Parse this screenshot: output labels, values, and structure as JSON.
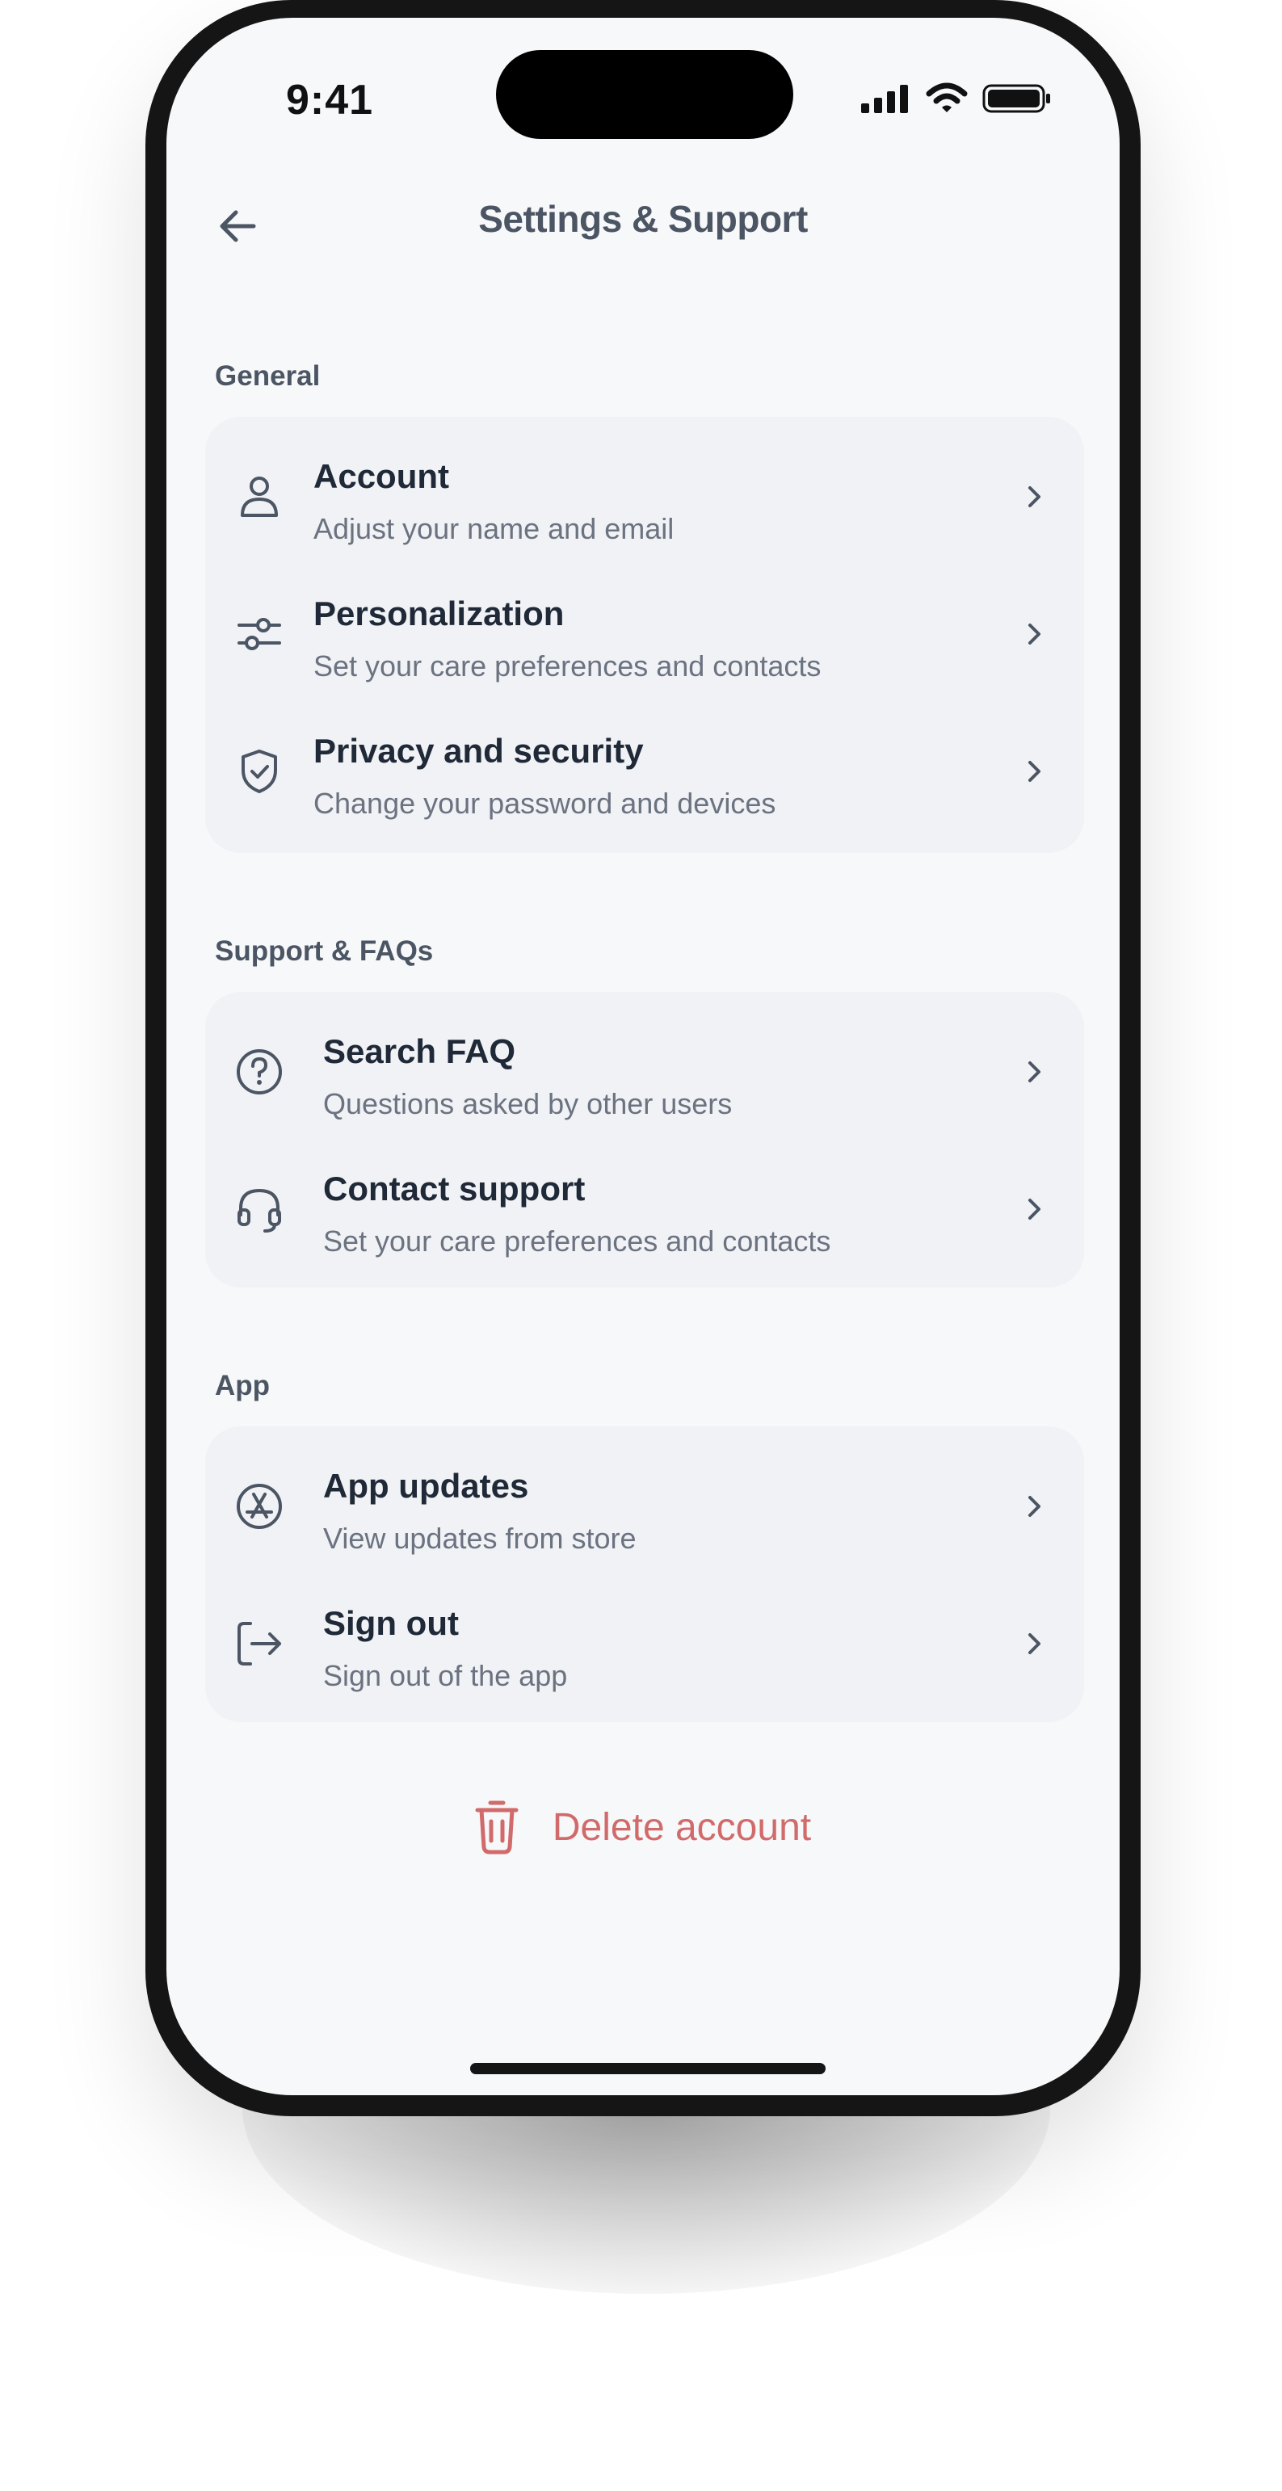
{
  "status_bar": {
    "time": "9:41"
  },
  "header": {
    "title": "Settings & Support",
    "back_icon": "arrow-left-icon"
  },
  "sections": [
    {
      "label": "General",
      "items": [
        {
          "title": "Account",
          "subtitle": "Adjust your name and email",
          "icon": "user-icon"
        },
        {
          "title": "Personalization",
          "subtitle": "Set your care preferences and contacts",
          "icon": "sliders-icon"
        },
        {
          "title": "Privacy and security",
          "subtitle": "Change your password and devices",
          "icon": "shield-check-icon"
        }
      ]
    },
    {
      "label": "Support & FAQs",
      "items": [
        {
          "title": "Search FAQ",
          "subtitle": "Questions asked by other users",
          "icon": "question-circle-icon"
        },
        {
          "title": "Contact support",
          "subtitle": "Set your care preferences and contacts",
          "icon": "headset-icon"
        }
      ]
    },
    {
      "label": "App",
      "items": [
        {
          "title": "App updates",
          "subtitle": "View updates from store",
          "icon": "app-store-icon"
        },
        {
          "title": "Sign out",
          "subtitle": "Sign out of the app",
          "icon": "sign-out-icon"
        }
      ]
    }
  ],
  "delete_account": {
    "label": "Delete account",
    "icon": "trash-icon"
  },
  "colors": {
    "background": "#f7f8fa",
    "card": "#f0f2f5",
    "title_text": "#1f2937",
    "subtitle_text": "#6b7280",
    "header_text": "#4b5563",
    "danger": "#d16a6a"
  }
}
